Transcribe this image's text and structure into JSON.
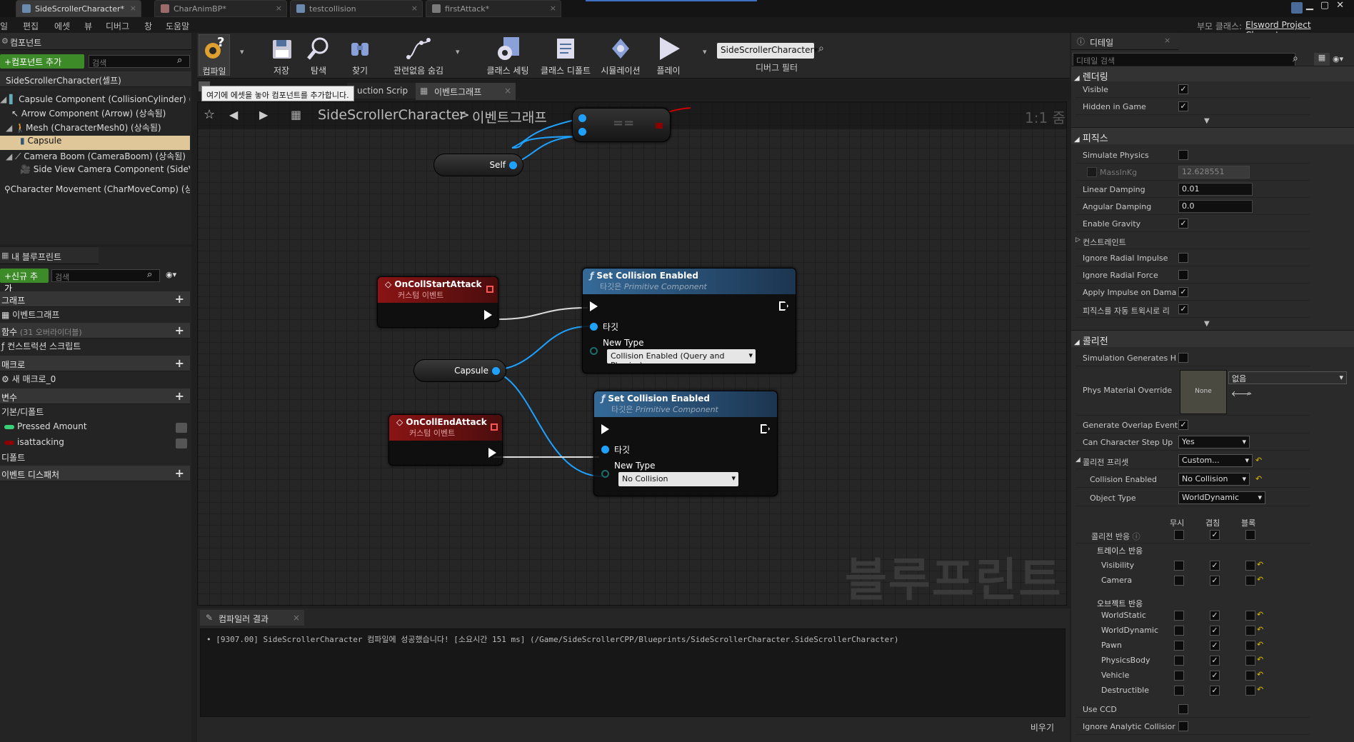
{
  "tabs": [
    {
      "label": "SideScrollerCharacter*",
      "active": true
    },
    {
      "label": "CharAnimBP*",
      "active": false
    },
    {
      "label": "testcollision",
      "active": false
    },
    {
      "label": "firstAttack*",
      "active": false
    }
  ],
  "menu": [
    "일",
    "편집",
    "에셋",
    "뷰",
    "디버그",
    "창",
    "도움말"
  ],
  "parent_class_label": "부모 클래스:",
  "parent_class_value": "Elsword Project Character",
  "components": {
    "title": "컴포넌트",
    "add_button": "+컴포넌트 추가",
    "search_placeholder": "검색",
    "self_row": "SideScrollerCharacter(셀프)",
    "items": [
      "Capsule Component (CollisionCylinder) (상속",
      "Arrow Component (Arrow) (상속됨)",
      "Mesh (CharacterMesh0) (상속됨)",
      "Capsule",
      "Camera Boom (CameraBoom) (상속됨)",
      "Side View Camera Component (SideView",
      "Character Movement (CharMoveComp) (상속"
    ]
  },
  "my_blueprint": {
    "title": "내 블루프린트",
    "add_button": "+신규 추가",
    "search_placeholder": "검색",
    "sections": {
      "graph": "그래프",
      "graph_item": "이벤트그래프",
      "functions": "함수",
      "functions_note": "(31 오버라이더블)",
      "construction": "컨스트럭션 스크립트",
      "macros": "매크로",
      "macro_item": "새 매크로_0",
      "variables": "변수",
      "var_category": "기본/디폴트",
      "var1": "Pressed Amount",
      "var2": "isattacking",
      "default": "디폴트",
      "dispatchers": "이벤트 디스패처"
    }
  },
  "toolbar": {
    "buttons": [
      "컴파일",
      "저장",
      "탐색",
      "찾기",
      "관련없음 숨김",
      "클래스 세팅",
      "클래스 디폴트",
      "시뮬레이션",
      "플레이"
    ],
    "debug_object": "SideScrollerCharacter▾",
    "debug_filter": "디버그 필터"
  },
  "graph_tabs": {
    "tooltip": "여기에 에셋을 놓아 컴포넌트를 추가합니다.",
    "construction_tab": "uction Scrip",
    "event_tab": "이벤트그래프"
  },
  "graph": {
    "breadcrumb_root": "SideScrollerCharacter",
    "breadcrumb_sep": ">",
    "breadcrumb_graph": "이벤트그래프",
    "zoom": "1:1 줌",
    "watermark": "블루프린트",
    "nodes": {
      "self": "Self",
      "event1_title": "OnCollStartAttack",
      "event1_sub": "커스텀 이벤트",
      "event2_title": "OnCollEndAttack",
      "event2_sub": "커스텀 이벤트",
      "capsule": "Capsule",
      "set1_title": "Set Collision Enabled",
      "set1_sub_prefix": "타깃은",
      "set1_sub": "Primitive Component",
      "set1_target": "타깃",
      "set1_newtype": "New Type",
      "set1_value": "Collision Enabled (Query and Physics)",
      "set2_title": "Set Collision Enabled",
      "set2_sub_prefix": "타깃은",
      "set2_sub": "Primitive Component",
      "set2_target": "타깃",
      "set2_newtype": "New Type",
      "set2_value": "No Collision"
    }
  },
  "compiler": {
    "tab": "컴파일러 결과",
    "message": "• [9307.00] SideScrollerCharacter 컴파일에 성공했습니다! [소요시간 151 ms] (/Game/SideScrollerCPP/Blueprints/SideScrollerCharacter.SideScrollerCharacter)",
    "clear": "비우기"
  },
  "details": {
    "title": "디테일",
    "search_placeholder": "디테일 검색",
    "rendering": "렌더링",
    "visible": "Visible",
    "hidden_in_game": "Hidden in Game",
    "physics": "피직스",
    "simulate_physics": "Simulate Physics",
    "mass": "MassInKg",
    "mass_value": "12.628551",
    "linear_damping": "Linear Damping",
    "linear_damping_value": "0.01",
    "angular_damping": "Angular Damping",
    "angular_damping_value": "0.0",
    "enable_gravity": "Enable Gravity",
    "constraints": "컨스트레인트",
    "ignore_radial_impulse": "Ignore Radial Impulse",
    "ignore_radial_force": "Ignore Radial Force",
    "apply_impulse": "Apply Impulse on Dama",
    "physics_bone": "피직스를 자동 트윅시로 리",
    "collision": "콜리전",
    "sim_generates_hit": "Simulation Generates H",
    "phys_material_override": "Phys Material Override",
    "phys_material_thumb": "None",
    "phys_material_value": "없음",
    "generate_overlap": "Generate Overlap Event",
    "can_step_up": "Can Character Step Up",
    "can_step_up_value": "Yes",
    "collision_presets": "콜리전 프리셋",
    "collision_presets_value": "Custom...",
    "collision_enabled": "Collision Enabled",
    "collision_enabled_value": "No Collision",
    "object_type": "Object Type",
    "object_type_value": "WorldDynamic",
    "col_ignore": "무시",
    "col_overlap": "겹침",
    "col_block": "블록",
    "collision_responses": "콜리전 반응",
    "trace_responses": "트레이스 반응",
    "visibility": "Visibility",
    "camera": "Camera",
    "object_responses": "오브젝트 반응",
    "world_static": "WorldStatic",
    "world_dynamic": "WorldDynamic",
    "pawn": "Pawn",
    "physics_body": "PhysicsBody",
    "vehicle": "Vehicle",
    "destructible": "Destructible",
    "use_ccd": "Use CCD",
    "ignore_analytic": "Ignore Analytic Collisior"
  }
}
